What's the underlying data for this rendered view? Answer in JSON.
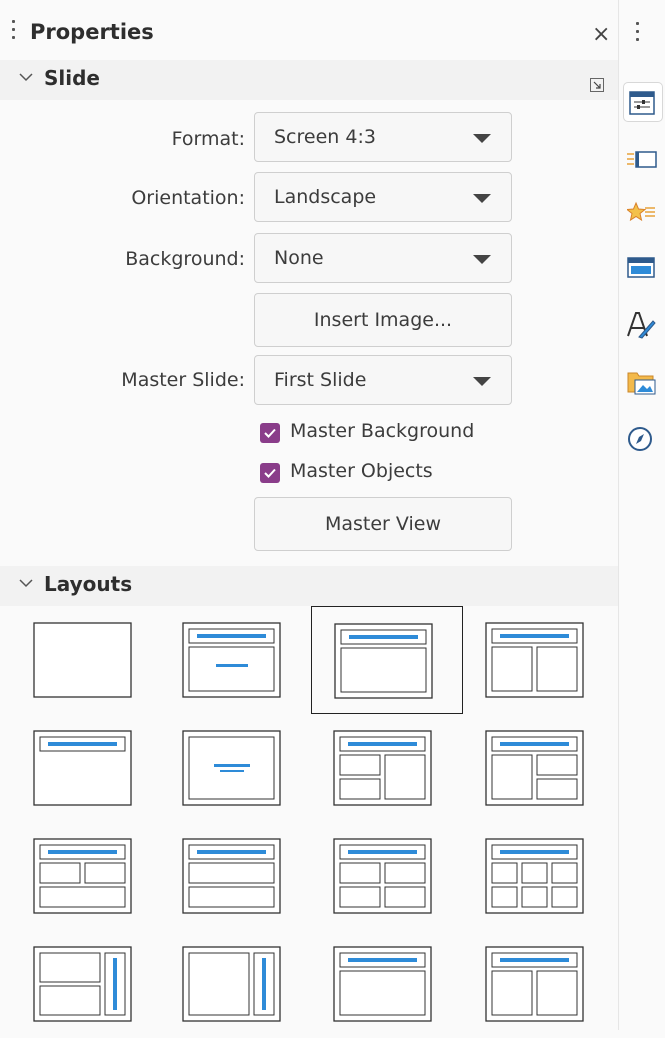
{
  "panel": {
    "title": "Properties",
    "close_glyph": "×"
  },
  "slide_section": {
    "title": "Slide",
    "format": {
      "label": "Format:",
      "value": "Screen 4:3"
    },
    "orientation": {
      "label": "Orientation:",
      "value": "Landscape"
    },
    "background": {
      "label": "Background:",
      "value": "None"
    },
    "insert_image_label": "Insert Image...",
    "master_slide": {
      "label": "Master Slide:",
      "value": "First Slide"
    },
    "master_background": {
      "label": "Master Background",
      "checked": true
    },
    "master_objects": {
      "label": "Master Objects",
      "checked": true
    },
    "master_view_label": "Master View"
  },
  "layouts_section": {
    "title": "Layouts",
    "selected_index": 2,
    "items": [
      "blank-slide",
      "title-slide",
      "title-content",
      "title-2-content",
      "title-only",
      "centered-text",
      "title-2-content-and-content",
      "title-content-and-2-content",
      "title-2-content-over-content",
      "title-content-over-content",
      "title-4-content",
      "title-6-content",
      "title-vertical-text-vertical-chart",
      "title-vertical-text",
      "title-vertical-content",
      "title-2-vertical-content"
    ]
  },
  "deck": {
    "buttons": [
      "properties-icon",
      "slide-transition-icon",
      "animation-icon",
      "master-slides-icon",
      "styles-icon",
      "gallery-icon",
      "navigator-icon"
    ],
    "active": "properties-icon"
  },
  "colors": {
    "accent_blue": "#2e8bd8",
    "checkbox_purple": "#8a3d8a"
  }
}
